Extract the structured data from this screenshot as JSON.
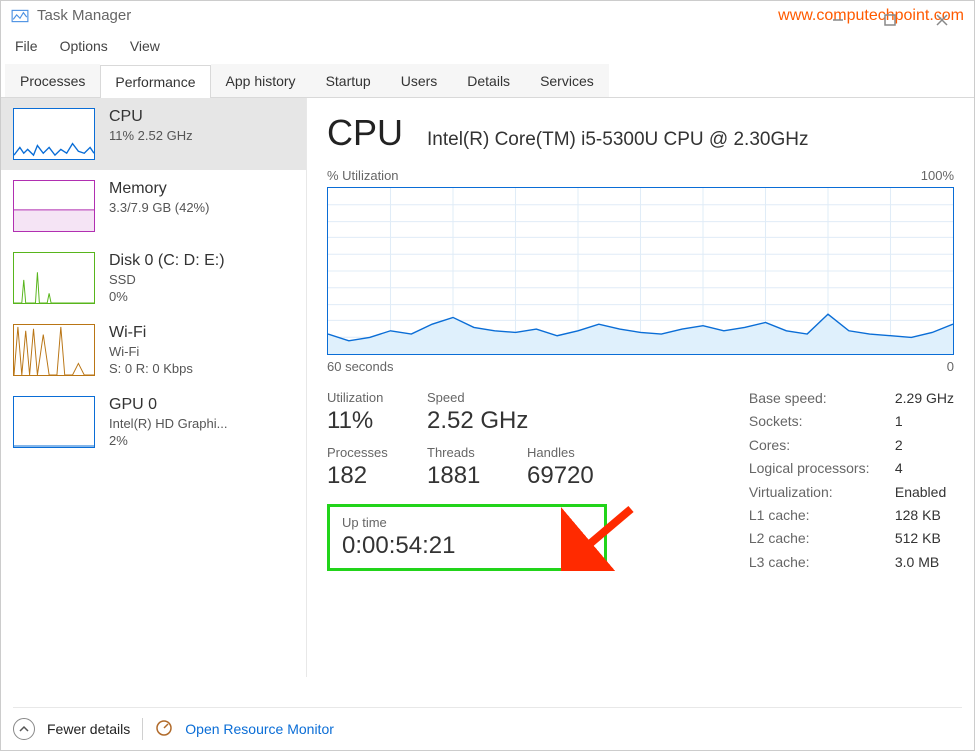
{
  "window": {
    "title": "Task Manager",
    "watermark": "www.computechpoint.com"
  },
  "menu": {
    "file": "File",
    "options": "Options",
    "view": "View"
  },
  "tabs": [
    "Processes",
    "Performance",
    "App history",
    "Startup",
    "Users",
    "Details",
    "Services"
  ],
  "active_tab_index": 1,
  "sidebar": [
    {
      "name": "cpu",
      "title": "CPU",
      "sub": "11% 2.52 GHz",
      "color": "#0a6dd6"
    },
    {
      "name": "memory",
      "title": "Memory",
      "sub": "3.3/7.9 GB (42%)",
      "color": "#b12fb1"
    },
    {
      "name": "disk0",
      "title": "Disk 0 (C: D: E:)",
      "sub": "SSD",
      "sub2": "0%",
      "color": "#58b51c"
    },
    {
      "name": "wifi",
      "title": "Wi-Fi",
      "sub": "Wi-Fi",
      "sub2": "S: 0 R: 0 Kbps",
      "color": "#b97515"
    },
    {
      "name": "gpu0",
      "title": "GPU 0",
      "sub": "Intel(R) HD Graphi...",
      "sub2": "2%",
      "color": "#0a6dd6"
    }
  ],
  "main": {
    "heading": "CPU",
    "model": "Intel(R) Core(TM) i5-5300U CPU @ 2.30GHz",
    "chart": {
      "label_left": "% Utilization",
      "label_right": "100%",
      "under_left": "60 seconds",
      "under_right": "0"
    },
    "stats": {
      "utilization": {
        "label": "Utilization",
        "value": "11%"
      },
      "speed": {
        "label": "Speed",
        "value": "2.52 GHz"
      },
      "processes": {
        "label": "Processes",
        "value": "182"
      },
      "threads": {
        "label": "Threads",
        "value": "1881"
      },
      "handles": {
        "label": "Handles",
        "value": "69720"
      },
      "uptime": {
        "label": "Up time",
        "value": "0:00:54:21"
      }
    },
    "specs": {
      "base_speed": {
        "k": "Base speed:",
        "v": "2.29 GHz"
      },
      "sockets": {
        "k": "Sockets:",
        "v": "1"
      },
      "cores": {
        "k": "Cores:",
        "v": "2"
      },
      "logical": {
        "k": "Logical processors:",
        "v": "4"
      },
      "virtualization": {
        "k": "Virtualization:",
        "v": "Enabled"
      },
      "l1": {
        "k": "L1 cache:",
        "v": "128 KB"
      },
      "l2": {
        "k": "L2 cache:",
        "v": "512 KB"
      },
      "l3": {
        "k": "L3 cache:",
        "v": "3.0 MB"
      }
    }
  },
  "footer": {
    "fewer": "Fewer details",
    "resource_monitor": "Open Resource Monitor"
  },
  "chart_data": {
    "type": "line",
    "title": "% Utilization",
    "ylabel": "% Utilization",
    "xlabel": "seconds",
    "xlim": [
      60,
      0
    ],
    "ylim": [
      0,
      100
    ],
    "x": [
      60,
      58,
      56,
      54,
      52,
      50,
      48,
      46,
      44,
      42,
      40,
      38,
      36,
      34,
      32,
      30,
      28,
      26,
      24,
      22,
      20,
      18,
      16,
      14,
      12,
      10,
      8,
      6,
      4,
      2,
      0
    ],
    "values": [
      12,
      8,
      10,
      14,
      12,
      18,
      22,
      16,
      14,
      13,
      15,
      11,
      14,
      18,
      15,
      13,
      12,
      15,
      17,
      14,
      16,
      19,
      14,
      12,
      24,
      14,
      12,
      11,
      10,
      13,
      18
    ]
  }
}
